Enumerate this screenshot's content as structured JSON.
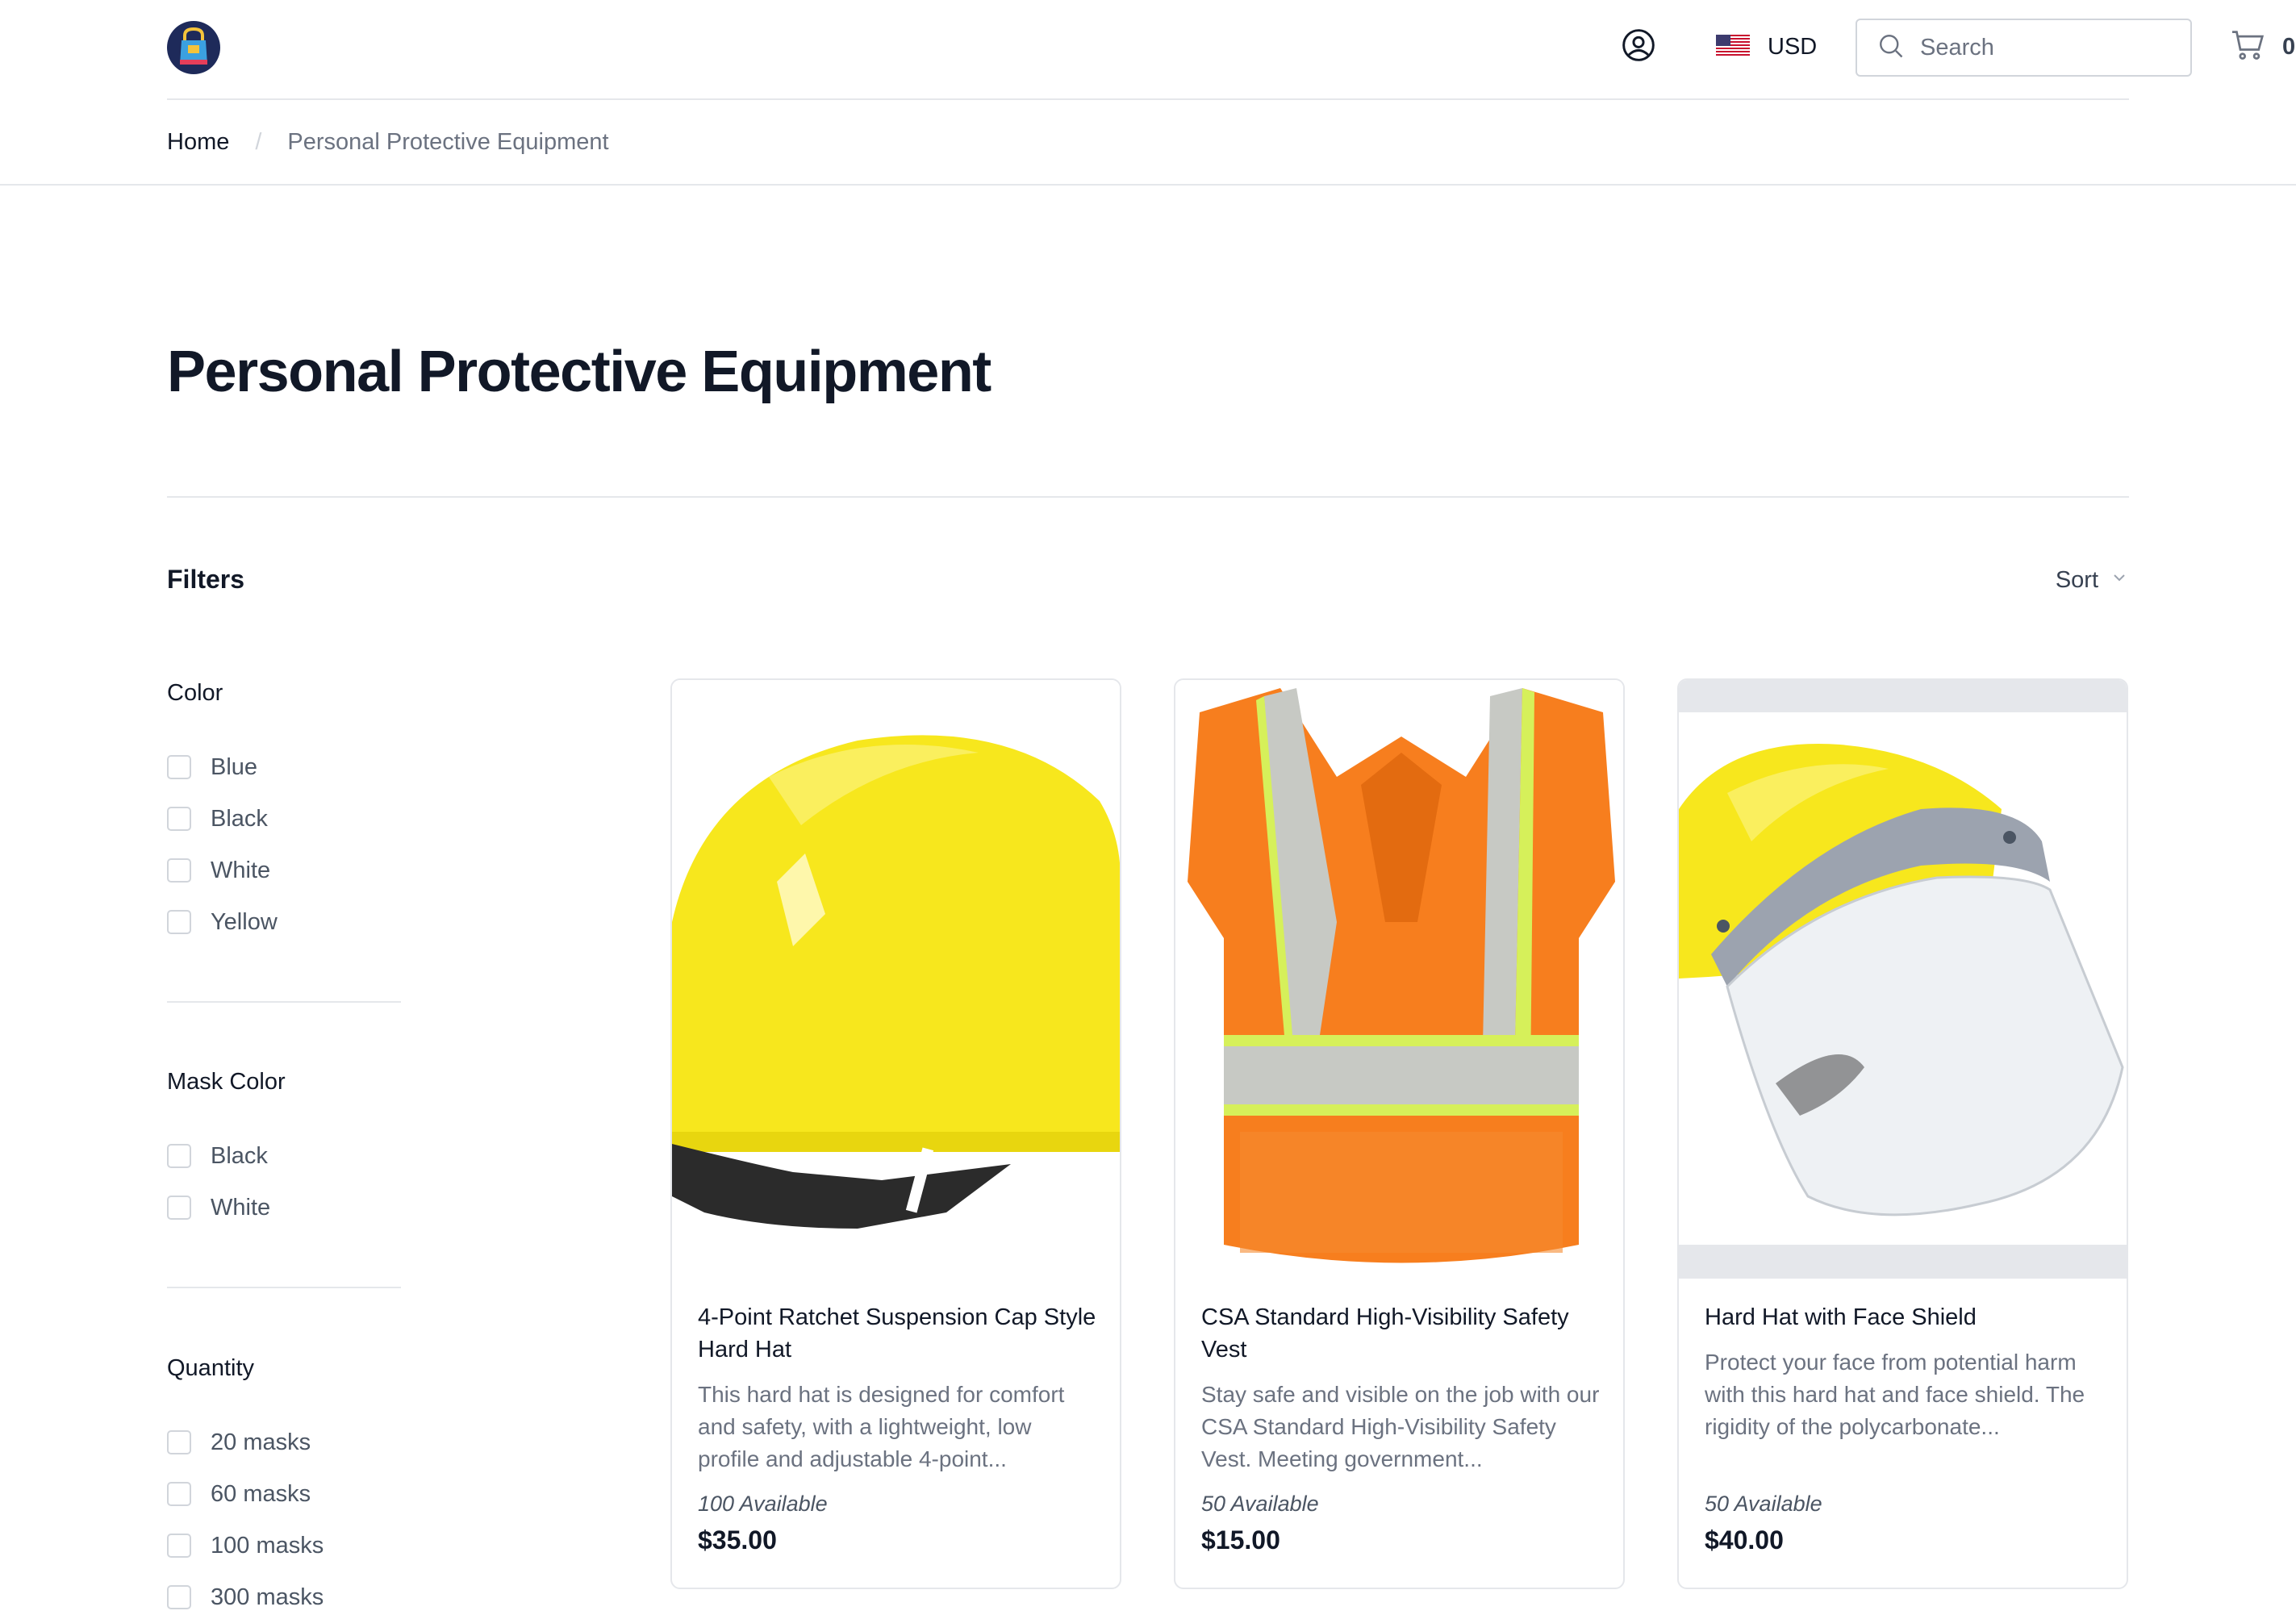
{
  "header": {
    "logo_icon": "shopping-bag-logo-icon",
    "account_icon": "user-circle-icon",
    "currency": {
      "flag_icon": "us-flag-icon",
      "code": "USD"
    },
    "search": {
      "placeholder": "Search",
      "value": "",
      "icon": "search-icon"
    },
    "cart": {
      "icon": "cart-icon",
      "count": "0"
    }
  },
  "breadcrumb": {
    "home": "Home",
    "separator": "/",
    "current": "Personal Protective Equipment"
  },
  "page": {
    "title": "Personal Protective Equipment"
  },
  "toolbar": {
    "filters_label": "Filters",
    "sort_label": "Sort",
    "sort_icon": "chevron-down-icon"
  },
  "filters": [
    {
      "title": "Color",
      "options": [
        "Blue",
        "Black",
        "White",
        "Yellow"
      ]
    },
    {
      "title": "Mask Color",
      "options": [
        "Black",
        "White"
      ]
    },
    {
      "title": "Quantity",
      "options": [
        "20 masks",
        "60 masks",
        "100 masks",
        "300 masks"
      ]
    }
  ],
  "products": [
    {
      "name": "4-Point Ratchet Suspension Cap Style Hard Hat",
      "description": "This hard hat is designed for comfort and safety, with a lightweight, low profile and adjustable 4-point...",
      "availability": "100 Available",
      "price": "$35.00"
    },
    {
      "name": "CSA Standard High-Visibility Safety Vest",
      "description": "Stay safe and visible on the job with our CSA Standard High-Visibility Safety Vest. Meeting government...",
      "availability": "50 Available",
      "price": "$15.00"
    },
    {
      "name": "Hard Hat with Face Shield",
      "description": "Protect your face from potential harm with this hard hat and face shield. The rigidity of the polycarbonate...",
      "availability": "50 Available",
      "price": "$40.00"
    }
  ],
  "colors": {
    "border": "#e5e7eb",
    "text": "#111827",
    "muted": "#6b7280",
    "hat_yellow": "#f7e71d",
    "vest_orange": "#f77e1e"
  }
}
